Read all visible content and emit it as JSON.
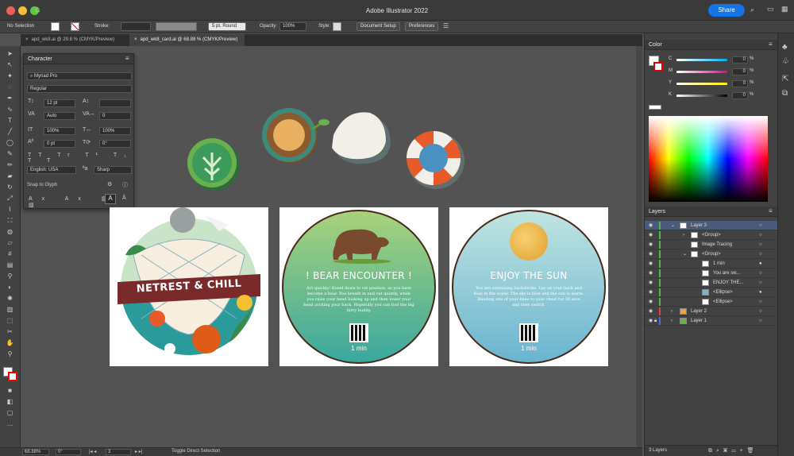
{
  "app": {
    "title": "Adobe Illustrator 2022",
    "share_label": "Share"
  },
  "control_bar": {
    "selection": "No Selection",
    "stroke_label": "Stroke:",
    "brush": "5 pt. Round",
    "opacity_label": "Opacity:",
    "opacity": "100%",
    "style_label": "Style:",
    "doc_setup": "Document Setup",
    "preferences": "Preferences"
  },
  "tabs": [
    {
      "label": "apd_wk8.ai @ 29.8 % (CMYK/Preview)"
    },
    {
      "label": "apd_wk8_card.ai @ 68.88 % (CMYK/Preview)"
    }
  ],
  "character": {
    "title": "Character",
    "font": "Myriad Pro",
    "style": "Regular",
    "size": "12 pt",
    "leading": "",
    "kerning": "Auto",
    "tracking": "0",
    "vscale": "100%",
    "hscale": "100%",
    "baseline": "0 pt",
    "rotation": "0°",
    "language": "English: USA",
    "aa": "Sharp",
    "snap": "Snap to Glyph"
  },
  "color": {
    "title": "Color",
    "channels": [
      {
        "name": "C",
        "value": "0"
      },
      {
        "name": "M",
        "value": "0"
      },
      {
        "name": "Y",
        "value": "0"
      },
      {
        "name": "K",
        "value": "0"
      }
    ],
    "percent": "%"
  },
  "layers": {
    "title": "Layers",
    "rows": [
      {
        "label": "Layer 3"
      },
      {
        "label": "<Group>"
      },
      {
        "label": "Image Tracing"
      },
      {
        "label": "<Group>"
      },
      {
        "label": "1 min"
      },
      {
        "label": "You are sw..."
      },
      {
        "label": "ENJOY THE..."
      },
      {
        "label": "<Ellipse>"
      },
      {
        "label": "<Ellipse>"
      },
      {
        "label": "Layer 2"
      },
      {
        "label": "Layer 1"
      }
    ],
    "count": "3 Layers"
  },
  "cards": [
    {
      "title": "NETREST & CHILL"
    },
    {
      "title": "! BEAR ENCOUNTER !",
      "body": "Act quickly! Kneel down to rat position, as you have become a bear. You breath in and out quietly, while you raise your head looking up and then lower your head arching your back. Hopefully you can fool the big furry buddy.",
      "time": "1 min"
    },
    {
      "title": "ENJOY THE SUN",
      "body": "You are swimming backstroke. Lay on your back and float in the water. The sky is blue and the sun is warm. Bending one of your knee to your chest for 30 secs and then switch.",
      "time": "1 min"
    }
  ],
  "status": {
    "zoom": "68.88%",
    "rotate": "0°",
    "artboard": "3",
    "tool": "Toggle Direct Selection"
  }
}
